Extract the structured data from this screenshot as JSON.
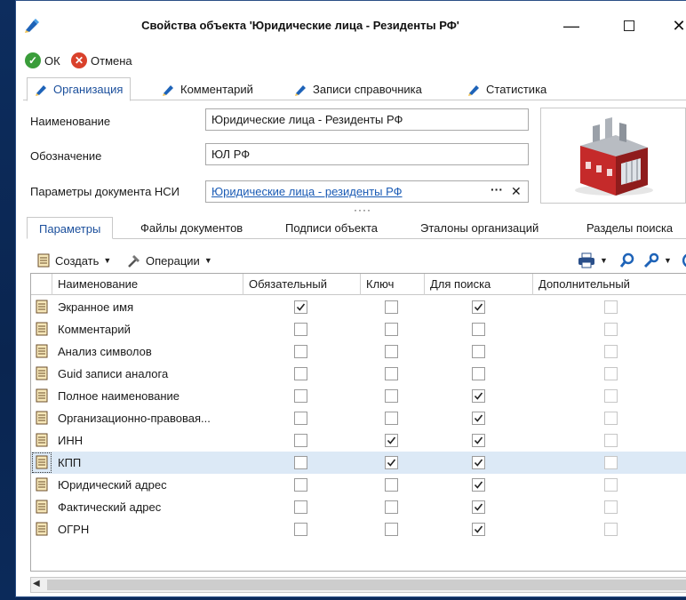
{
  "window": {
    "title": "Свойства объекта 'Юридические лица - Резиденты РФ'",
    "minimize": "—",
    "close": "✕"
  },
  "actions": {
    "ok": "ОК",
    "cancel": "Отмена"
  },
  "main_tabs": [
    {
      "label": "Организация",
      "active": true
    },
    {
      "label": "Комментарий",
      "active": false
    },
    {
      "label": "Записи справочника",
      "active": false
    },
    {
      "label": "Статистика",
      "active": false
    }
  ],
  "form": {
    "name_label": "Наименование",
    "name_value": "Юридические лица - Резиденты РФ",
    "designation_label": "Обозначение",
    "designation_value": "ЮЛ РФ",
    "nsi_label": "Параметры документа НСИ",
    "nsi_value": "Юридические лица - резиденты РФ",
    "nsi_more": "···",
    "nsi_clear": "✕",
    "splitter": "····"
  },
  "sub_tabs": [
    {
      "label": "Параметры",
      "active": true
    },
    {
      "label": "Файлы документов",
      "active": false
    },
    {
      "label": "Подписи объекта",
      "active": false
    },
    {
      "label": "Эталоны организаций",
      "active": false
    },
    {
      "label": "Разделы поиска",
      "active": false
    }
  ],
  "grid_toolbar": {
    "create": "Создать",
    "operations": "Операции"
  },
  "grid": {
    "columns": [
      "Наименование",
      "Обязательный",
      "Ключ",
      "Для поиска",
      "Дополнительный"
    ],
    "rows": [
      {
        "name": "Экранное имя",
        "required": true,
        "key": false,
        "search": true,
        "extra": false
      },
      {
        "name": "Комментарий",
        "required": false,
        "key": false,
        "search": false,
        "extra": false
      },
      {
        "name": "Анализ символов",
        "required": false,
        "key": false,
        "search": false,
        "extra": false
      },
      {
        "name": "Guid записи аналога",
        "required": false,
        "key": false,
        "search": false,
        "extra": false
      },
      {
        "name": "Полное наименование",
        "required": false,
        "key": false,
        "search": true,
        "extra": false
      },
      {
        "name": "Организационно-правовая...",
        "required": false,
        "key": false,
        "search": true,
        "extra": false
      },
      {
        "name": "ИНН",
        "required": false,
        "key": true,
        "search": true,
        "extra": false
      },
      {
        "name": "КПП",
        "required": false,
        "key": true,
        "search": true,
        "extra": false,
        "selected": true
      },
      {
        "name": "Юридический адрес",
        "required": false,
        "key": false,
        "search": true,
        "extra": false
      },
      {
        "name": "Фактический адрес",
        "required": false,
        "key": false,
        "search": true,
        "extra": false
      },
      {
        "name": "ОГРН",
        "required": false,
        "key": false,
        "search": true,
        "extra": false
      }
    ]
  },
  "colors": {
    "accent": "#1b4f9c",
    "link": "#1a5bb5",
    "ok_green": "#3a9d3a",
    "cancel_red": "#d9412b",
    "selected_row": "#dce9f6"
  }
}
